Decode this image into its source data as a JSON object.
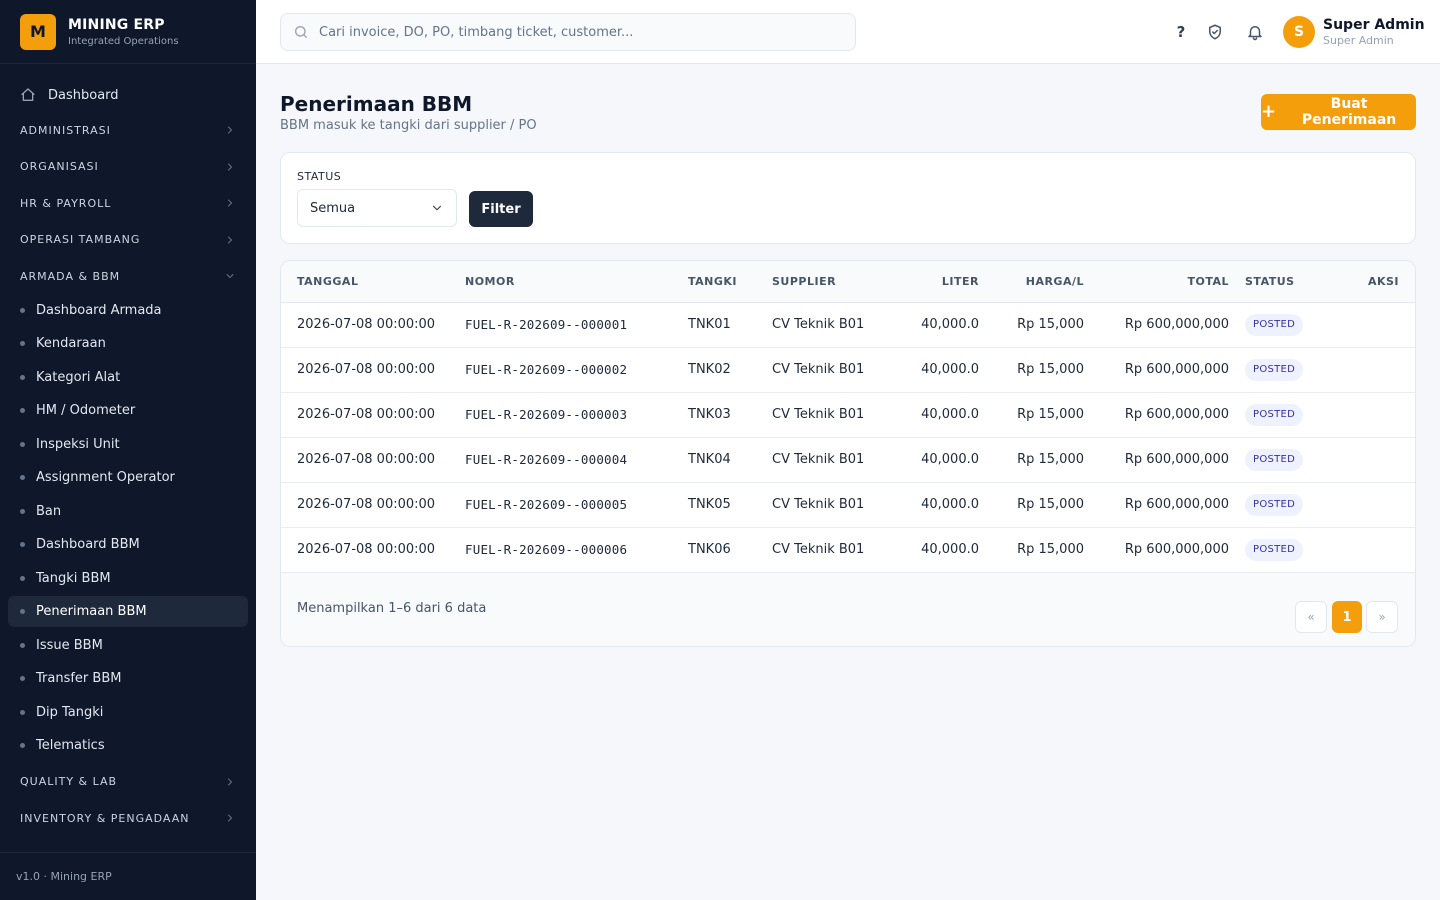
{
  "brand": {
    "logo_letter": "M",
    "title": "MINING ERP",
    "subtitle": "Integrated Operations"
  },
  "sidebar": {
    "dashboard_label": "Dashboard",
    "groups_top": [
      "ADMINISTRASI",
      "ORGANISASI",
      "HR & PAYROLL",
      "OPERASI TAMBANG"
    ],
    "armada_group": "ARMADA & BBM",
    "armada_items": [
      "Dashboard Armada",
      "Kendaraan",
      "Kategori Alat",
      "HM / Odometer",
      "Inspeksi Unit",
      "Assignment Operator",
      "Ban",
      "Dashboard BBM",
      "Tangki BBM",
      "Penerimaan BBM",
      "Issue BBM",
      "Transfer BBM",
      "Dip Tangki",
      "Telematics"
    ],
    "active_item": "Penerimaan BBM",
    "groups_bottom": [
      "QUALITY & LAB",
      "INVENTORY & PENGADAAN"
    ],
    "footer": "v1.0 · Mining ERP"
  },
  "topbar": {
    "search_placeholder": "Cari invoice, DO, PO, timbang ticket, customer...",
    "help": "?",
    "avatar_letter": "S",
    "user_name": "Super Admin",
    "user_role": "Super Admin"
  },
  "page": {
    "title": "Penerimaan BBM",
    "subtitle": "BBM masuk ke tangki dari supplier / PO",
    "create_button": "Buat Penerimaan"
  },
  "filter": {
    "label": "STATUS",
    "selected": "Semua",
    "button": "Filter"
  },
  "table": {
    "headers": [
      "TANGGAL",
      "NOMOR",
      "TANGKI",
      "SUPPLIER",
      "LITER",
      "HARGA/L",
      "TOTAL",
      "STATUS",
      "AKSI"
    ],
    "rows": [
      {
        "tanggal": "2026-07-08 00:00:00",
        "nomor": "FUEL-R-202609--000001",
        "tangki": "TNK01",
        "supplier": "CV Teknik B01",
        "liter": "40,000.0",
        "harga": "Rp 15,000",
        "total": "Rp 600,000,000",
        "status": "POSTED"
      },
      {
        "tanggal": "2026-07-08 00:00:00",
        "nomor": "FUEL-R-202609--000002",
        "tangki": "TNK02",
        "supplier": "CV Teknik B01",
        "liter": "40,000.0",
        "harga": "Rp 15,000",
        "total": "Rp 600,000,000",
        "status": "POSTED"
      },
      {
        "tanggal": "2026-07-08 00:00:00",
        "nomor": "FUEL-R-202609--000003",
        "tangki": "TNK03",
        "supplier": "CV Teknik B01",
        "liter": "40,000.0",
        "harga": "Rp 15,000",
        "total": "Rp 600,000,000",
        "status": "POSTED"
      },
      {
        "tanggal": "2026-07-08 00:00:00",
        "nomor": "FUEL-R-202609--000004",
        "tangki": "TNK04",
        "supplier": "CV Teknik B01",
        "liter": "40,000.0",
        "harga": "Rp 15,000",
        "total": "Rp 600,000,000",
        "status": "POSTED"
      },
      {
        "tanggal": "2026-07-08 00:00:00",
        "nomor": "FUEL-R-202609--000005",
        "tangki": "TNK05",
        "supplier": "CV Teknik B01",
        "liter": "40,000.0",
        "harga": "Rp 15,000",
        "total": "Rp 600,000,000",
        "status": "POSTED"
      },
      {
        "tanggal": "2026-07-08 00:00:00",
        "nomor": "FUEL-R-202609--000006",
        "tangki": "TNK06",
        "supplier": "CV Teknik B01",
        "liter": "40,000.0",
        "harga": "Rp 15,000",
        "total": "Rp 600,000,000",
        "status": "POSTED"
      }
    ],
    "footer_text": "Menampilkan 1–6 dari 6 data",
    "pager": {
      "prev": "«",
      "current": "1",
      "next": "»"
    }
  },
  "colors": {
    "accent": "#f59e0b",
    "sidebar_bg": "#0f172a",
    "dark_button": "#1e293b",
    "badge_bg": "#eef2ff",
    "badge_text": "#3730a3"
  }
}
